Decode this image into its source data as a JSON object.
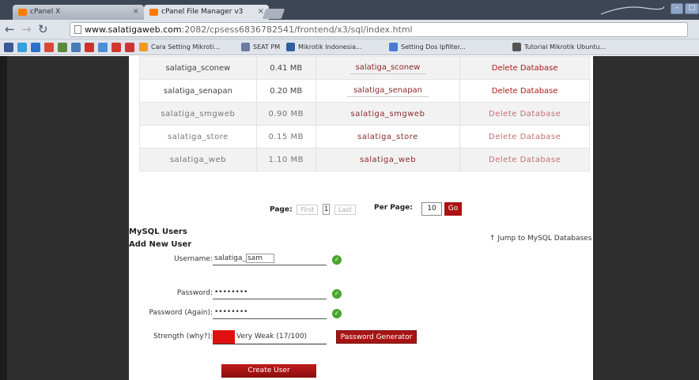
{
  "browser": {
    "tabs": [
      {
        "label": "cPanel X",
        "active": false
      },
      {
        "label": "cPanel File Manager v3",
        "active": true
      }
    ],
    "url_host": "www.salatigaweb.com",
    "url_path": ":2082/cpsess6836782541/frontend/x3/sql/index.html",
    "bookmarks": [
      {
        "label": "Cara Setting Mikroti..."
      },
      {
        "label": "SEAT PM"
      },
      {
        "label": "Mikrotik Indonesia..."
      },
      {
        "label": "Setting Dos Ipfilter..."
      },
      {
        "label": "Tutorial Mikrotik Ubuntu..."
      }
    ]
  },
  "databases": [
    {
      "name": "salatiga_sconew",
      "size": "0.41 MB",
      "user": "salatiga_sconew",
      "action": "Delete Database"
    },
    {
      "name": "salatiga_senapan",
      "size": "0.20 MB",
      "user": "salatiga_senapan",
      "action": "Delete Database"
    },
    {
      "name": "salatiga_smgweb",
      "size": "0.90 MB",
      "user": "salatiga_smgweb",
      "action": "Delete Database"
    },
    {
      "name": "salatiga_store",
      "size": "0.15 MB",
      "user": "salatiga_store",
      "action": "Delete Database"
    },
    {
      "name": "salatiga_web",
      "size": "1.10 MB",
      "user": "salatiga_web",
      "action": "Delete Database"
    }
  ],
  "pagination": {
    "page_label": "Page:",
    "first": "First",
    "page_number": "1",
    "last": "Last",
    "per_page_label": "Per Page:",
    "per_page_value": "10",
    "go_label": "Go"
  },
  "users_section": {
    "title": "MySQL Users",
    "subtitle": "Add New User",
    "jump_link": "↑ Jump to MySQL Databases",
    "username_label": "Username:",
    "username_prefix": "salatiga_",
    "username_value": "sam",
    "password_label": "Password:",
    "password_value": "••••••••",
    "password_again_label": "Password (Again):",
    "password_again_value": "••••••••",
    "strength_label": "Strength (why?):",
    "strength_text": "Very Weak (17/100)",
    "password_generator_label": "Password Generator",
    "create_user_label": "Create User"
  },
  "colors": {
    "accent": "#a81414",
    "check": "#48a52e",
    "strength_very_weak": "#e01010"
  }
}
